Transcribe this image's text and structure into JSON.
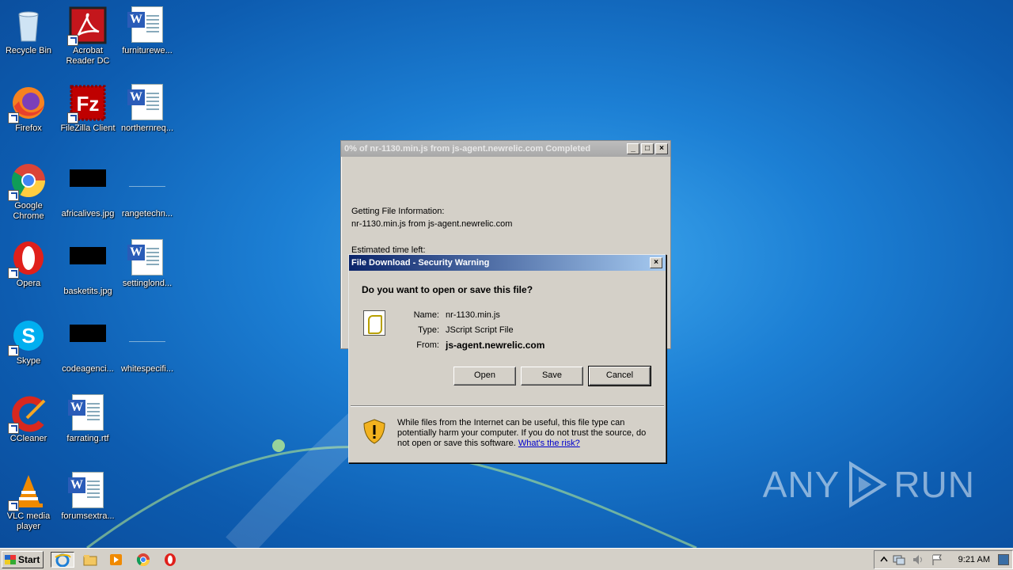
{
  "desktop": {
    "icons": [
      {
        "label": "Recycle Bin",
        "icon": "recycle-bin-icon"
      },
      {
        "label": "Acrobat Reader DC",
        "icon": "acrobat-icon"
      },
      {
        "label": "furniturewe...",
        "icon": "word-doc-icon"
      },
      {
        "label": "Firefox",
        "icon": "firefox-icon"
      },
      {
        "label": "FileZilla Client",
        "icon": "filezilla-icon"
      },
      {
        "label": "northernreq...",
        "icon": "word-doc-icon"
      },
      {
        "label": "Google Chrome",
        "icon": "chrome-icon"
      },
      {
        "label": "africalives.jpg",
        "icon": "jpg-thumbnail-icon"
      },
      {
        "label": "rangetechn...",
        "icon": "file-icon"
      },
      {
        "label": "Opera",
        "icon": "opera-icon"
      },
      {
        "label": "basketits.jpg",
        "icon": "jpg-thumbnail-icon"
      },
      {
        "label": "settinglond...",
        "icon": "word-doc-icon"
      },
      {
        "label": "Skype",
        "icon": "skype-icon"
      },
      {
        "label": "codeagenci...",
        "icon": "jpg-thumbnail-icon"
      },
      {
        "label": "whitespecifi...",
        "icon": "file-icon"
      },
      {
        "label": "CCleaner",
        "icon": "ccleaner-icon"
      },
      {
        "label": "farrating.rtf",
        "icon": "word-doc-icon"
      },
      {
        "label": "VLC media player",
        "icon": "vlc-icon"
      },
      {
        "label": "forumsextra...",
        "icon": "word-doc-icon"
      }
    ]
  },
  "progress_window": {
    "title": "0% of nr-1130.min.js from js-agent.newrelic.com Completed",
    "status_label": "Getting File Information:",
    "status_detail": "nr-1130.min.js from js-agent.newrelic.com",
    "estimated_label": "Estimated time left:"
  },
  "security_dialog": {
    "title": "File Download - Security Warning",
    "question": "Do you want to open or save this file?",
    "name_label": "Name:",
    "name_value": "nr-1130.min.js",
    "type_label": "Type:",
    "type_value": "JScript Script File",
    "from_label": "From:",
    "from_value": "js-agent.newrelic.com",
    "open_label": "Open",
    "save_label": "Save",
    "cancel_label": "Cancel",
    "warning_text": "While files from the Internet can be useful, this file type can potentially harm your computer. If you do not trust the source, do not open or save this software.",
    "risk_link": "What's the risk?"
  },
  "watermark": {
    "text_left": "ANY",
    "text_right": "RUN"
  },
  "taskbar": {
    "start_label": "Start",
    "clock": "9:21 AM"
  }
}
